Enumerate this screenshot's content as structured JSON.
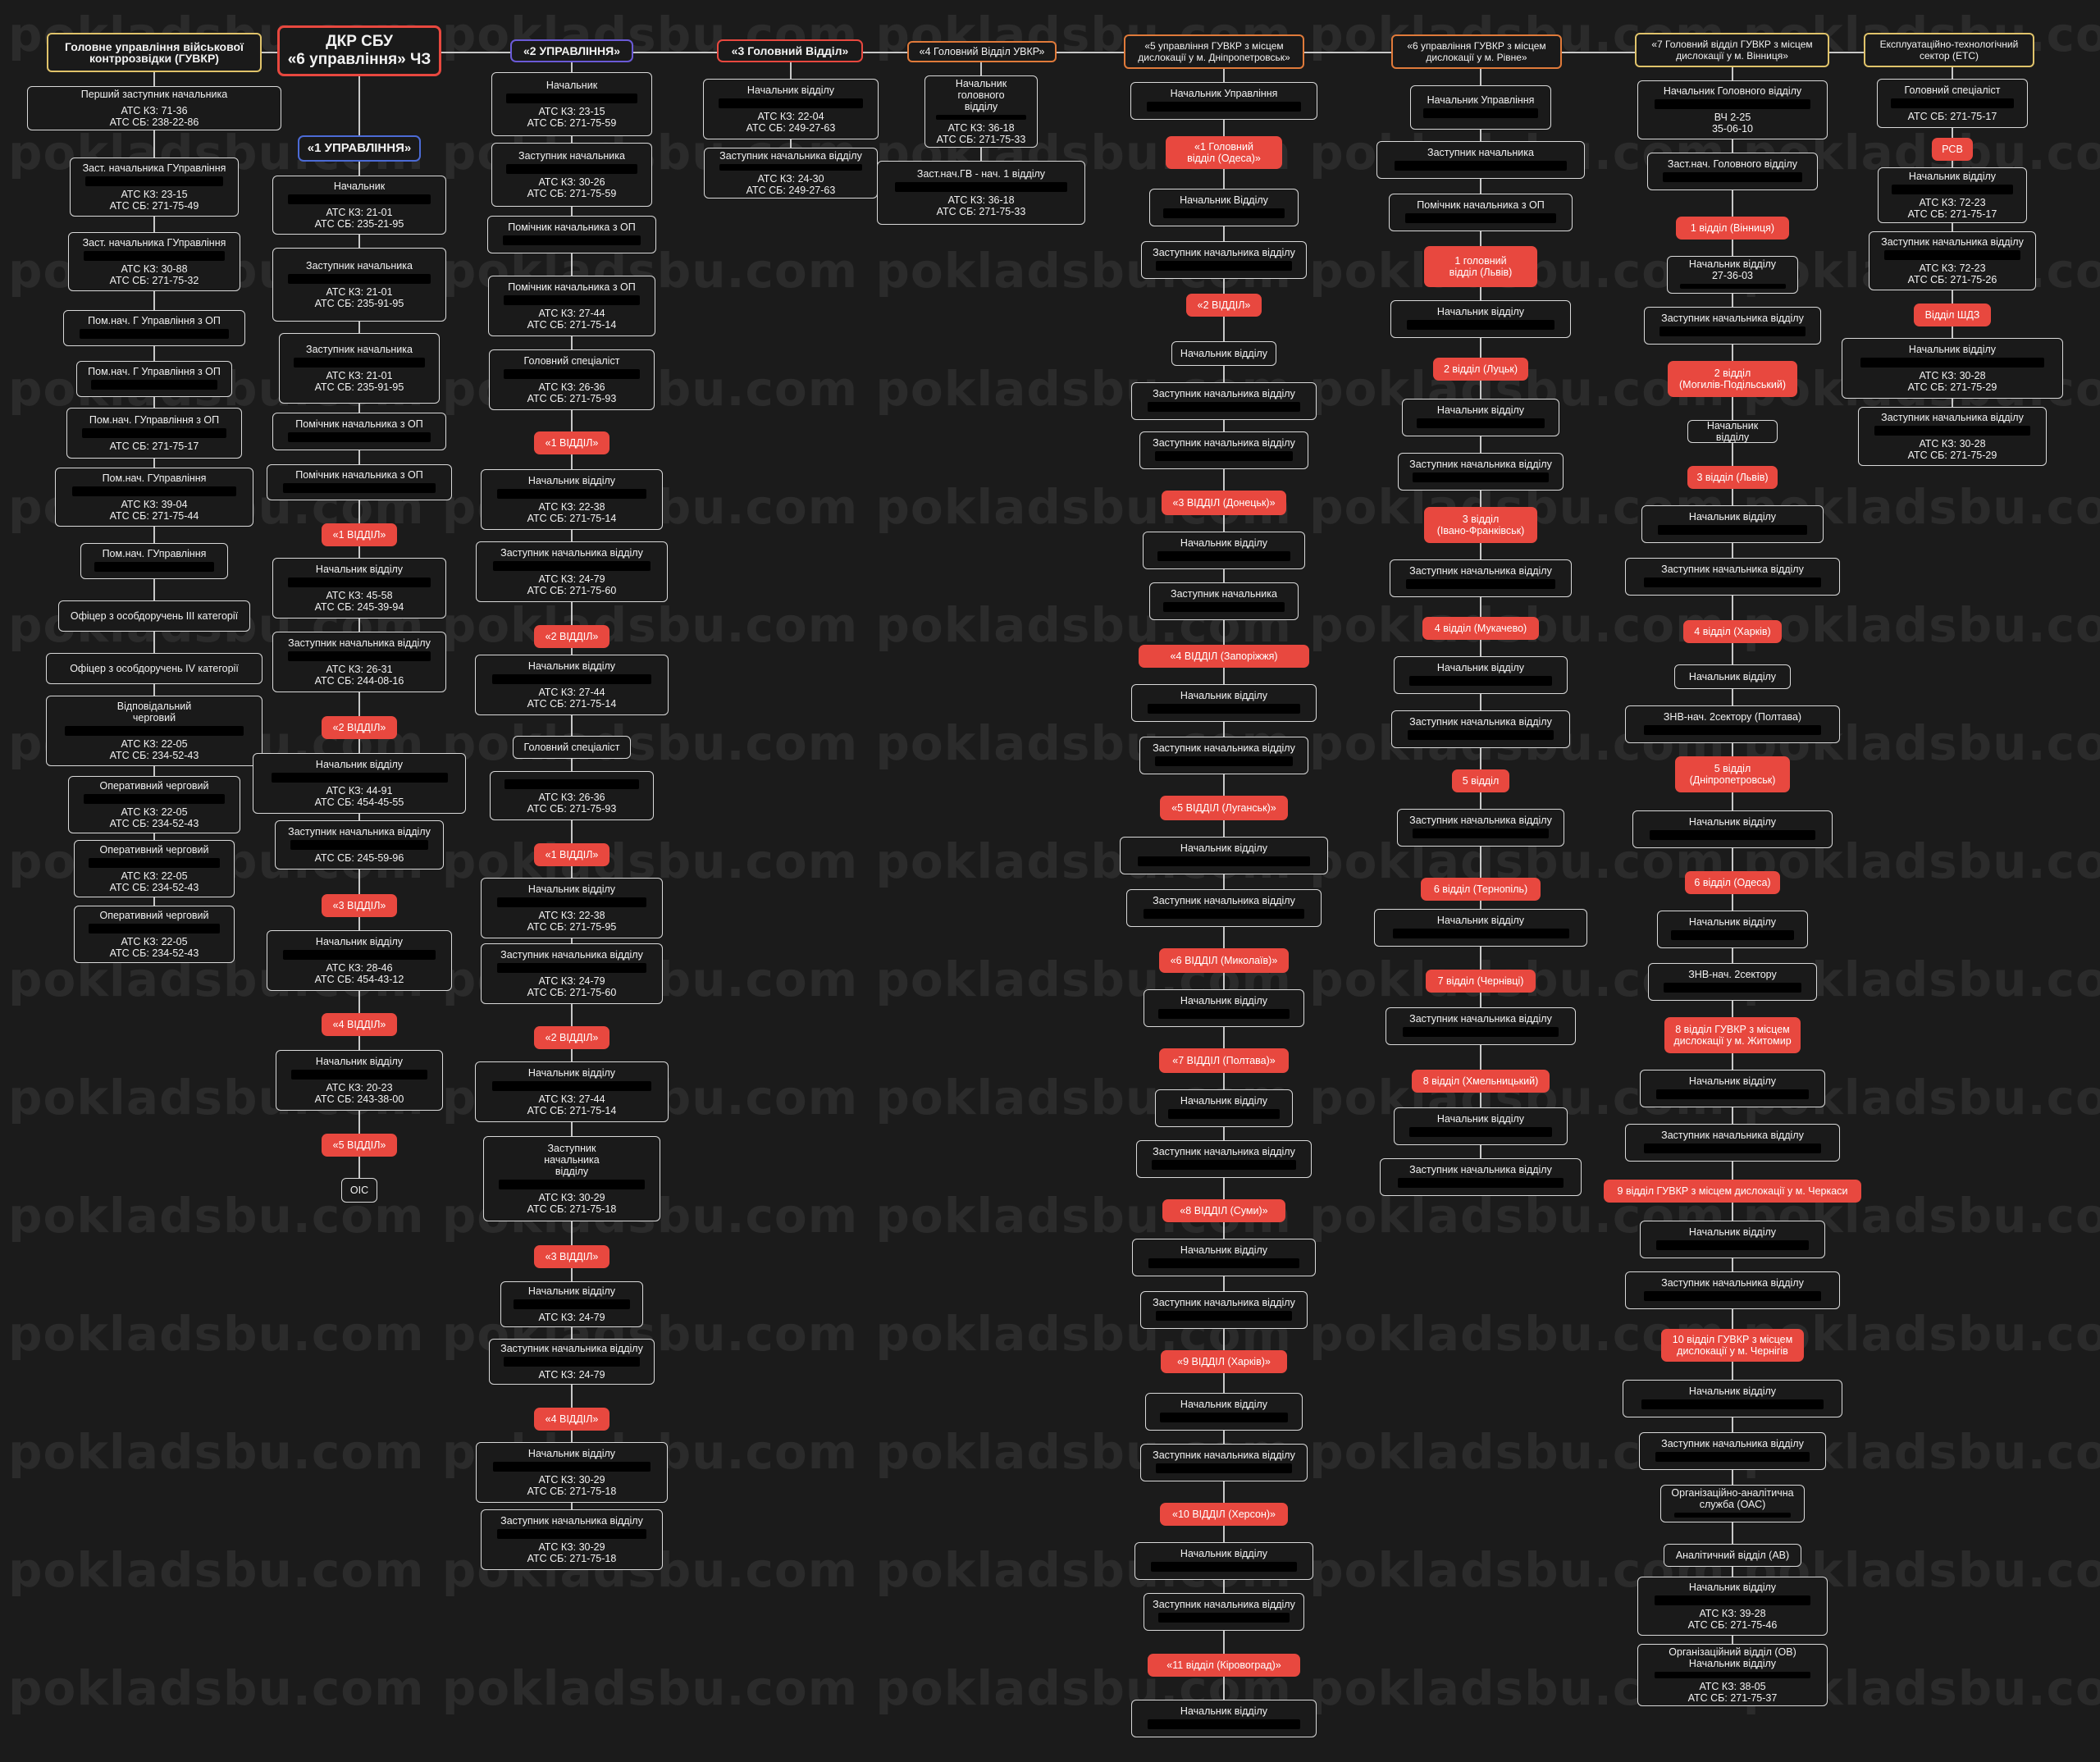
{
  "watermark": "pokladsbu.com",
  "colors": {
    "background": "#1b1b1b",
    "accent_red": "#e8483f",
    "connector": "#c8c8c8",
    "node_border": "#d9d9d9",
    "blue_border": "#4c6bd6",
    "purple_border": "#6a5ad6",
    "yellow_border": "#e0c36a",
    "orange_border": "#e07a3a"
  },
  "header": {
    "root_title": "ДКР СБУ\n«6 управління» ЧЗ",
    "gur": "Головне управління військової\nконтррозвідки (ГУВКР)",
    "u2": "«2 УПРАВЛІННЯ»",
    "gv3": "«3 Головний Відділ»",
    "gv4": "«4 Головний Відділ УВКР»",
    "u5": "«5 управління ГУВКР з місцем\nдислокації у м. Дніпропетровськ»",
    "u6": "«6 управління ГУВКР з місцем\nдислокації у м. Рівне»",
    "gv7": "«7 Головний відділ ГУВКР з місцем\nдислокації у м. Вінниця»",
    "ets": "Експлуатаційно-технологічний\nсектор (ЕТС)"
  },
  "col_gur": [
    {
      "label": "Перший заступник начальника",
      "phones": "АТС КЗ: 71-36\nАТС СБ: 238-22-86"
    },
    {
      "label": "Заст. начальника ГУправління",
      "phones": "АТС КЗ: 23-15\nАТС СБ: 271-75-49"
    },
    {
      "label": "Заст. начальника ГУправління",
      "phones": "АТС КЗ: 30-88\nАТС СБ: 271-75-32"
    },
    {
      "label": "Пом.нач. Г Управління з ОП"
    },
    {
      "label": "Пом.нач. Г Управління з ОП"
    },
    {
      "label": "Пом.нач. ГУправління з ОП",
      "phones": "АТС СБ: 271-75-17"
    },
    {
      "label": "Пом.нач. ГУправління",
      "phones": "АТС КЗ: 39-04\nАТС СБ: 271-75-44"
    },
    {
      "label": "Пом.нач. ГУправління"
    },
    {
      "label": "Офіцер з особдоручень ІІІ категорії"
    },
    {
      "label": "Офіцер з особдоручень IV категорії"
    },
    {
      "label": "Відповідальний\nчерговий",
      "phones": "АТС КЗ: 22-05\nАТС СБ: 234-52-43"
    },
    {
      "label": "Оперативний черговий",
      "phones": "АТС КЗ: 22-05\nАТС СБ: 234-52-43"
    },
    {
      "label": "Оперативний черговий",
      "phones": "АТС КЗ: 22-05\nАТС СБ: 234-52-43"
    },
    {
      "label": "Оперативний черговий",
      "phones": "АТС КЗ: 22-05\nАТС СБ: 234-52-43"
    }
  ],
  "col_u1": {
    "title": "«1 УПРАВЛІННЯ»",
    "items": [
      {
        "label": "Начальник",
        "phones": "АТС КЗ: 21-01\nАТС СБ: 235-21-95"
      },
      {
        "label": "Заступник начальника",
        "phones": "АТС КЗ: 21-01\nАТС СБ: 235-91-95"
      },
      {
        "label": "Заступник начальника",
        "phones": "АТС КЗ: 21-01\nАТС СБ: 235-91-95"
      },
      {
        "label": "Помічник начальника з ОП"
      },
      {
        "label": "Помічник начальника з ОП"
      },
      {
        "label": "«1 ВІДДІЛ»",
        "red": true
      },
      {
        "label": "Начальник відділу",
        "phones": "АТС КЗ: 45-58\nАТС СБ: 245-39-94"
      },
      {
        "label": "Заступник начальника відділу",
        "phones": "АТС КЗ: 26-31\nАТС СБ: 244-08-16"
      },
      {
        "label": "«2 ВІДДІЛ»",
        "red": true
      },
      {
        "label": "Начальник відділу",
        "phones": "АТС КЗ: 44-91\nАТС СБ: 454-45-55"
      },
      {
        "label": "Заступник начальника відділу",
        "phones": "АТС СБ: 245-59-96"
      },
      {
        "label": "«3 ВІДДІЛ»",
        "red": true
      },
      {
        "label": "Начальник відділу",
        "phones": "АТС КЗ: 28-46\nАТС СБ: 454-43-12"
      },
      {
        "label": "«4 ВІДДІЛ»",
        "red": true
      },
      {
        "label": "Начальник відділу",
        "phones": "АТС КЗ: 20-23\nАТС СБ: 243-38-00"
      },
      {
        "label": "«5 ВІДДІЛ»",
        "red": true
      },
      {
        "label": "ОІС"
      }
    ]
  },
  "col_u2": [
    {
      "label": "Начальник",
      "phones": "АТС КЗ: 23-15\nАТС СБ: 271-75-59"
    },
    {
      "label": "Заступник начальника",
      "phones": "АТС КЗ: 30-26\nАТС СБ: 271-75-59"
    },
    {
      "label": "Помічник начальника з ОП"
    },
    {
      "label": "Помічник начальника з ОП",
      "phones": "АТС КЗ: 27-44\nАТС СБ: 271-75-14"
    },
    {
      "label": "Головний спеціаліст",
      "phones": "АТС КЗ: 26-36\nАТС СБ: 271-75-93"
    },
    {
      "label": "«1 ВІДДІЛ»",
      "red": true
    },
    {
      "label": "Начальник відділу",
      "phones": "АТС КЗ: 22-38\nАТС СБ: 271-75-14"
    },
    {
      "label": "Заступник начальника відділу",
      "phones": "АТС КЗ: 24-79\nАТС СБ: 271-75-60"
    },
    {
      "label": "«2 ВІДДІЛ»",
      "red": true
    },
    {
      "label": "Начальник відділу",
      "phones": "АТС КЗ: 27-44\nАТС СБ: 271-75-14"
    },
    {
      "label": "Головний спеціаліст"
    },
    {
      "label": "",
      "phones": "АТС КЗ: 26-36\nАТС СБ: 271-75-93"
    },
    {
      "label": "«1 ВІДДІЛ»",
      "red": true
    },
    {
      "label": "Начальник відділу",
      "phones": "АТС КЗ: 22-38\nАТС СБ: 271-75-95"
    },
    {
      "label": "Заступник начальника відділу",
      "phones": "АТС КЗ: 24-79\nАТС СБ: 271-75-60"
    },
    {
      "label": "«2 ВІДДІЛ»",
      "red": true
    },
    {
      "label": "Начальник відділу",
      "phones": "АТС КЗ: 27-44\nАТС СБ: 271-75-14"
    },
    {
      "label": "Заступник\nначальника\nвідділу",
      "phones": "АТС КЗ: 30-29\nАТС СБ: 271-75-18"
    },
    {
      "label": "«3 ВІДДІЛ»",
      "red": true
    },
    {
      "label": "Начальник відділу",
      "phones": "АТС КЗ: 24-79"
    },
    {
      "label": "Заступник начальника відділу",
      "phones": "АТС КЗ: 24-79"
    },
    {
      "label": "«4 ВІДДІЛ»",
      "red": true
    },
    {
      "label": "Начальник відділу",
      "phones": "АТС КЗ: 30-29\nАТС СБ: 271-75-18"
    },
    {
      "label": "Заступник начальника відділу",
      "phones": "АТС КЗ: 30-29\nАТС СБ: 271-75-18"
    }
  ],
  "col_gv3": [
    {
      "label": "Начальник відділу",
      "phones": "АТС КЗ: 22-04\nАТС СБ: 249-27-63"
    },
    {
      "label": "Заступник начальника відділу",
      "phones": "АТС КЗ: 24-30\nАТС СБ: 249-27-63"
    }
  ],
  "col_gv4": [
    {
      "label": "Начальник\nголовного\nвідділу",
      "phones": "АТС КЗ: 36-18\nАТС СБ: 271-75-33"
    },
    {
      "label": "Заст.нач.ГВ - нач. 1 відділу",
      "phones": "АТС КЗ: 36-18\nАТС СБ: 271-75-33"
    }
  ],
  "col_u5": [
    {
      "label": "Начальник Управління"
    },
    {
      "label": "«1 Головний\nвідділ (Одеса)»",
      "red": true
    },
    {
      "label": "Начальник Відділу"
    },
    {
      "label": "Заступник начальника відділу"
    },
    {
      "label": "«2 ВІДДІЛ»",
      "red": true
    },
    {
      "label": "Начальник відділу"
    },
    {
      "label": "Заступник начальника відділу"
    },
    {
      "label": "Заступник начальника відділу"
    },
    {
      "label": "«3 ВІДДІЛ (Донецьк)»",
      "red": true
    },
    {
      "label": "Начальник відділу"
    },
    {
      "label": "Заступник начальника"
    },
    {
      "label": "«4 ВІДДІЛ (Запоріжжя)",
      "red": true
    },
    {
      "label": "Начальник відділу"
    },
    {
      "label": "Заступник начальника відділу"
    },
    {
      "label": "«5 ВІДДІЛ (Луганськ)»",
      "red": true
    },
    {
      "label": "Начальник відділу"
    },
    {
      "label": "Заступник начальника відділу"
    },
    {
      "label": "«6 ВІДДІЛ (Миколаїв)»",
      "red": true
    },
    {
      "label": "Начальник відділу"
    },
    {
      "label": "«7 ВІДДІЛ (Полтава)»",
      "red": true
    },
    {
      "label": "Начальник відділу"
    },
    {
      "label": "Заступник начальника відділу"
    },
    {
      "label": "«8 ВІДДІЛ (Суми)»",
      "red": true
    },
    {
      "label": "Начальник відділу"
    },
    {
      "label": "Заступник начальника відділу"
    },
    {
      "label": "«9 ВІДДІЛ (Харків)»",
      "red": true
    },
    {
      "label": "Начальник відділу"
    },
    {
      "label": "Заступник начальника відділу"
    },
    {
      "label": "«10 ВІДДІЛ (Херсон)»",
      "red": true
    },
    {
      "label": "Начальник відділу"
    },
    {
      "label": "Заступник начальника відділу"
    },
    {
      "label": "«11 відділ (Кіровоград)»",
      "red": true
    },
    {
      "label": "Начальник відділу"
    }
  ],
  "col_u6": [
    {
      "label": "Начальник Управління"
    },
    {
      "label": "Заступник начальника"
    },
    {
      "label": "Помічник начальника з ОП"
    },
    {
      "label": "1 головний\nвідділ (Львів)",
      "red": true
    },
    {
      "label": "Начальник відділу"
    },
    {
      "label": "2 відділ (Луцьк)",
      "red": true
    },
    {
      "label": "Начальник відділу"
    },
    {
      "label": "Заступник начальника відділу"
    },
    {
      "label": "3 відділ\n(Івано-Франківськ)",
      "red": true
    },
    {
      "label": "Заступник начальника відділу"
    },
    {
      "label": "4 відділ (Мукачево)",
      "red": true
    },
    {
      "label": "Начальник відділу"
    },
    {
      "label": "Заступник начальника відділу"
    },
    {
      "label": "5 відділ",
      "red": true
    },
    {
      "label": "Заступник начальника відділу"
    },
    {
      "label": "6 відділ (Тернопіль)",
      "red": true
    },
    {
      "label": "Начальник відділу"
    },
    {
      "label": "7 відділ (Чернівці)",
      "red": true
    },
    {
      "label": "Заступник начальника відділу"
    },
    {
      "label": "8 відділ (Хмельницький)",
      "red": true
    },
    {
      "label": "Начальник відділу"
    },
    {
      "label": "Заступник начальника відділу"
    }
  ],
  "col_gv7": [
    {
      "label": "Начальник Головного відділу",
      "phones": "ВЧ 2-25\n35-06-10"
    },
    {
      "label": "Заст.нач. Головного відділу"
    },
    {
      "label": "1 відділ (Вінниця)",
      "red": true
    },
    {
      "label": "Начальник відділу\n27-36-03"
    },
    {
      "label": "Заступник начальника відділу"
    },
    {
      "label": "2 відділ\n(Могилів-Подільський)",
      "red": true
    },
    {
      "label": "Начальник відділу"
    },
    {
      "label": "3 відділ (Львів)",
      "red": true
    },
    {
      "label": "Начальник відділу"
    },
    {
      "label": "Заступник начальника відділу"
    },
    {
      "label": "4 відділ (Харків)",
      "red": true
    },
    {
      "label": "Начальник відділу"
    },
    {
      "label": "ЗНВ-нач. 2сектору (Полтава)"
    },
    {
      "label": "5 відділ\n(Дніпропетровськ)",
      "red": true
    },
    {
      "label": "Начальник відділу"
    },
    {
      "label": "6 відділ (Одеса)",
      "red": true
    },
    {
      "label": "Начальник відділу"
    },
    {
      "label": "ЗНВ-нач. 2сектору"
    },
    {
      "label": "8 відділ ГУВКР з місцем\nдислокації у м. Житомир",
      "red": true
    },
    {
      "label": "Начальник відділу"
    },
    {
      "label": "Заступник начальника відділу"
    },
    {
      "label": "9 відділ ГУВКР з місцем дислокації у м. Черкаси",
      "red": true
    },
    {
      "label": "Начальник відділу"
    },
    {
      "label": "Заступник начальника відділу"
    },
    {
      "label": "10 відділ ГУВКР з місцем\nдислокації у м. Чернігів",
      "red": true
    },
    {
      "label": "Начальник відділу"
    },
    {
      "label": "Заступник начальника відділу"
    },
    {
      "label": "Організаційно-аналітична\nслужба (ОАС)"
    },
    {
      "label": "Аналітичний відділ (АВ)"
    },
    {
      "label": "Начальник відділу",
      "phones": "АТС КЗ: 39-28\nАТС СБ: 271-75-46"
    },
    {
      "label": "Організаційний відділ (ОВ)\nНачальник відділу",
      "phones": "АТС КЗ: 38-05\nАТС СБ: 271-75-37"
    }
  ],
  "col_ets": [
    {
      "label": "Головний спеціаліст",
      "phones": "АТС СБ: 271-75-17"
    },
    {
      "label": "РСВ",
      "red": true
    },
    {
      "label": "Начальник відділу",
      "phones": "АТС КЗ: 72-23\nАТС СБ: 271-75-17"
    },
    {
      "label": "Заступник начальника відділу",
      "phones": "АТС КЗ: 72-23\nАТС СБ: 271-75-26"
    },
    {
      "label": "Відділ ШДЗ",
      "red": true
    },
    {
      "label": "Начальник відділу",
      "phones": "АТС КЗ: 30-28\nАТС СБ: 271-75-29"
    },
    {
      "label": "Заступник начальника відділу",
      "phones": "АТС КЗ: 30-28\nАТС СБ: 271-75-29"
    }
  ]
}
